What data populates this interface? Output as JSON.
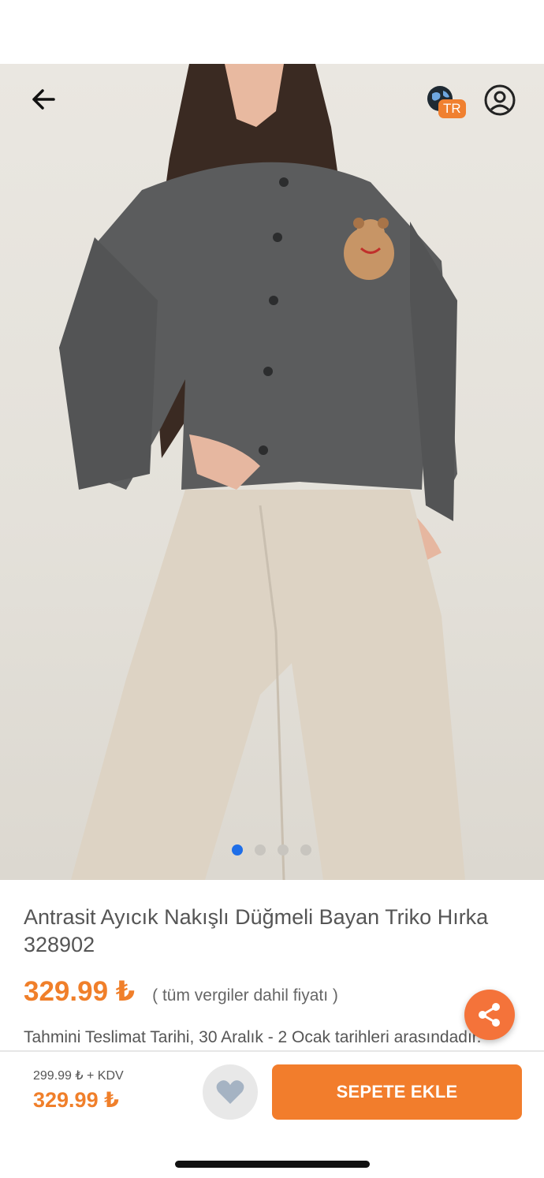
{
  "colors": {
    "accent": "#f27d2c",
    "active_dot": "#1e6ee8",
    "badge": "#f08030"
  },
  "header": {
    "back_icon": "arrow-left-icon",
    "language_icon": "globe-icon",
    "language_badge": "TR",
    "profile_icon": "user-circle-icon"
  },
  "gallery": {
    "image_count": 4,
    "active_index": 0
  },
  "product": {
    "title": "Antrasit Ayıcık Nakışlı Düğmeli Bayan Triko Hırka 328902",
    "price": "329.99 ₺",
    "price_note": "( tüm vergiler dahil fiyatı )",
    "delivery": "Tahmini Teslimat Tarihi, 30 Aralık - 2 Ocak tarihleri arasındadır."
  },
  "share": {
    "icon": "share-icon"
  },
  "bottom_bar": {
    "old_price": "299.99 ₺ + KDV",
    "current_price": "329.99 ₺",
    "favorite_icon": "heart-icon",
    "add_to_cart_label": "SEPETE EKLE"
  }
}
